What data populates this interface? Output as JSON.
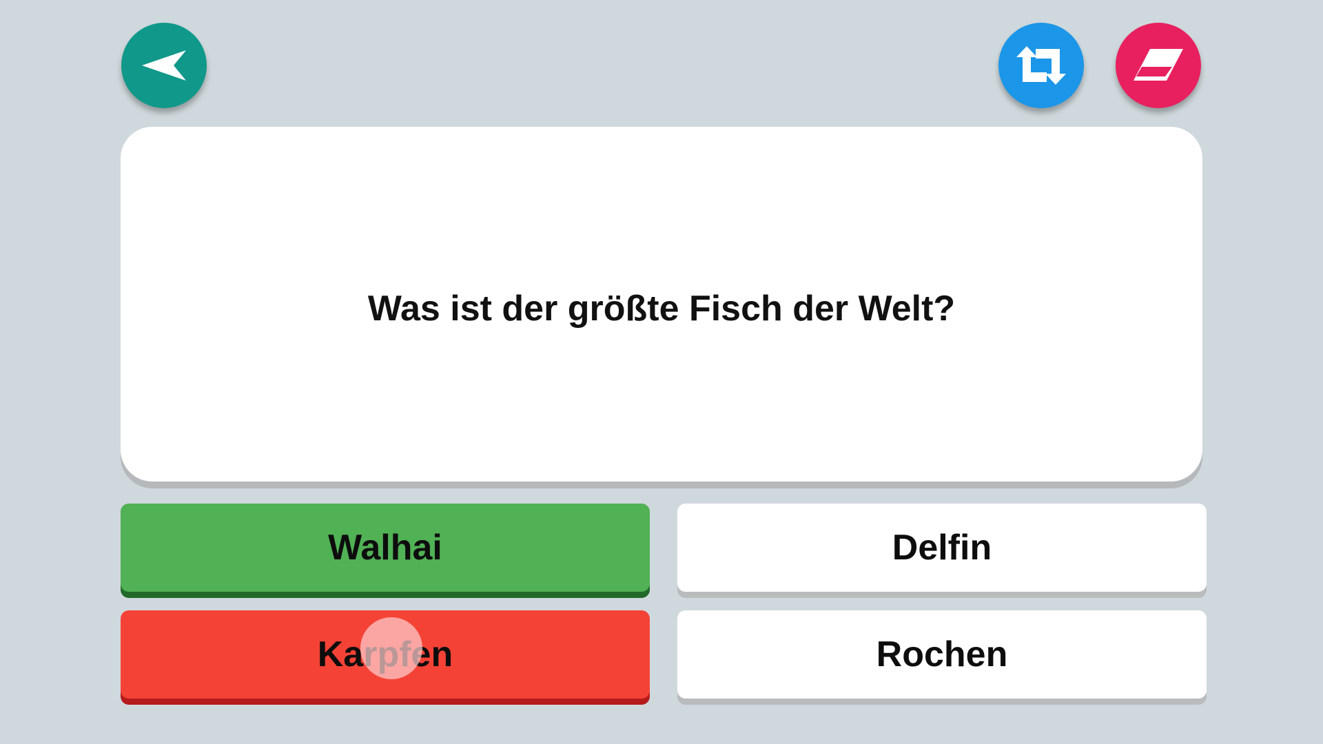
{
  "toolbar": {
    "back_icon": "arrow-back-icon",
    "shuffle_icon": "repeat-icon",
    "erase_icon": "eraser-icon"
  },
  "question": {
    "text": "Was ist der größte Fisch der Welt?"
  },
  "answers": [
    {
      "label": "Walhai",
      "state": "correct"
    },
    {
      "label": "Delfin",
      "state": "neutral"
    },
    {
      "label": "Karpfen",
      "state": "wrong"
    },
    {
      "label": "Rochen",
      "state": "neutral"
    }
  ],
  "colors": {
    "background": "#cfd8dc",
    "back_button": "#10988a",
    "shuffle_button": "#1b96e8",
    "erase_button": "#e8205f",
    "correct": "#50b155",
    "wrong": "#f44336",
    "neutral": "#ffffff"
  }
}
